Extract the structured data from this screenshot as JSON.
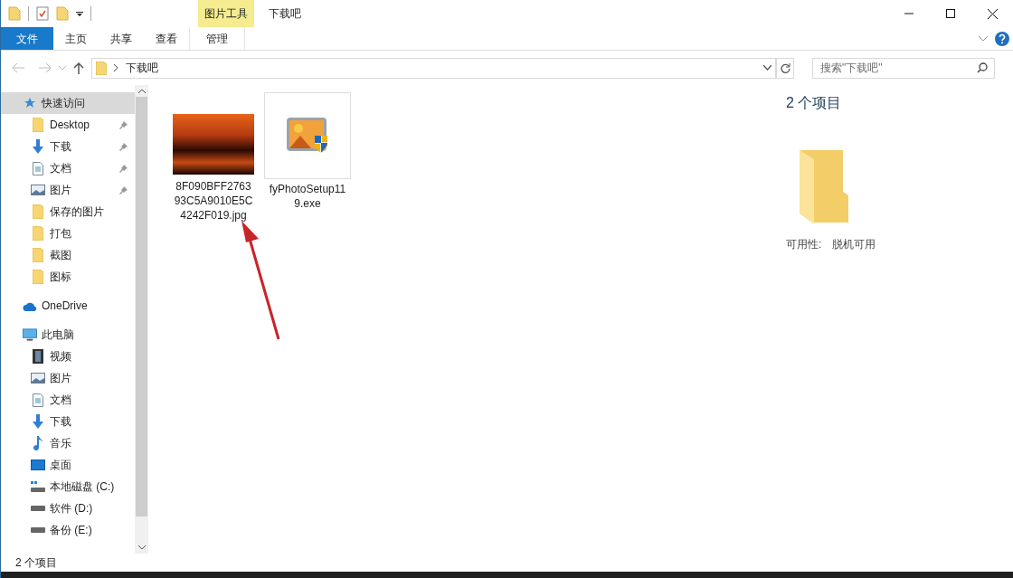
{
  "window": {
    "title": "下载吧",
    "context_tab_group": "图片工具"
  },
  "ribbon_tabs": [
    {
      "label": "文件",
      "kind": "file",
      "selected": false
    },
    {
      "label": "主页",
      "kind": "tab",
      "selected": false
    },
    {
      "label": "共享",
      "kind": "tab",
      "selected": false
    },
    {
      "label": "查看",
      "kind": "tab",
      "selected": false
    },
    {
      "label": "管理",
      "kind": "context",
      "selected": false
    }
  ],
  "address_bar": {
    "path": [
      "下载吧"
    ]
  },
  "search": {
    "placeholder": "搜索\"下载吧\""
  },
  "sidebar": {
    "items": [
      {
        "label": "快速访问",
        "kind": "star",
        "selected": true,
        "children": [
          {
            "label": "Desktop",
            "kind": "folder",
            "pinned": true,
            "selected": false
          },
          {
            "label": "下载",
            "kind": "download",
            "pinned": true,
            "selected": false
          },
          {
            "label": "文档",
            "kind": "document",
            "pinned": true,
            "selected": false
          },
          {
            "label": "图片",
            "kind": "picture",
            "pinned": true,
            "selected": false
          },
          {
            "label": "保存的图片",
            "kind": "folder",
            "pinned": false,
            "selected": false
          },
          {
            "label": "打包",
            "kind": "folder",
            "pinned": false,
            "selected": false
          },
          {
            "label": "截图",
            "kind": "folder",
            "pinned": false,
            "selected": false
          },
          {
            "label": "图标",
            "kind": "folder",
            "pinned": false,
            "selected": false
          }
        ]
      },
      {
        "label": "OneDrive",
        "kind": "cloud",
        "selected": false
      },
      {
        "label": "此电脑",
        "kind": "pc",
        "selected": false,
        "children": [
          {
            "label": "视频",
            "kind": "video",
            "selected": false
          },
          {
            "label": "图片",
            "kind": "picture",
            "selected": false
          },
          {
            "label": "文档",
            "kind": "document",
            "selected": false
          },
          {
            "label": "下载",
            "kind": "download",
            "selected": false
          },
          {
            "label": "音乐",
            "kind": "music",
            "selected": false
          },
          {
            "label": "桌面",
            "kind": "desktop",
            "selected": false
          },
          {
            "label": "本地磁盘 (C:)",
            "kind": "system-drive",
            "selected": false
          },
          {
            "label": "软件 (D:)",
            "kind": "drive",
            "selected": false
          },
          {
            "label": "备份 (E:)",
            "kind": "drive",
            "selected": false
          }
        ]
      }
    ]
  },
  "files": [
    {
      "name": "8F090BFF276393C5A9010E5C4242F019.jpg",
      "kind": "photo",
      "selected": false
    },
    {
      "name": "fyPhotoSetup119.exe",
      "kind": "installer",
      "selected": false
    }
  ],
  "details_pane": {
    "title": "2 个项目",
    "availability_label": "可用性:",
    "availability_value": "脱机可用"
  },
  "status_bar": {
    "text": "2 个项目"
  }
}
